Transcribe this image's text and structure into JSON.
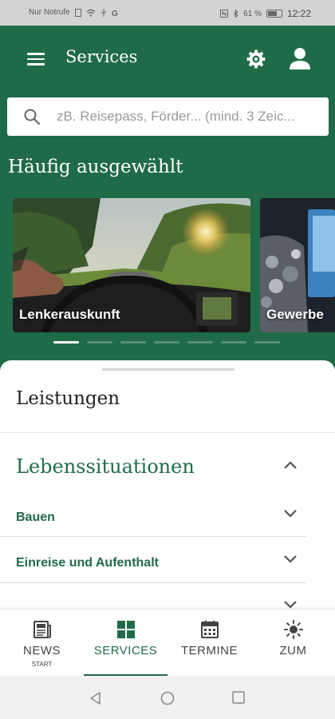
{
  "status_bar": {
    "carrier": "Nur Notrufe",
    "battery": "61 %",
    "time": "12:22"
  },
  "app_bar": {
    "title": "Services"
  },
  "search": {
    "placeholder": "zB. Reisepass, Förder... (mind. 3 Zeic..."
  },
  "frequent": {
    "title": "Häufig ausgewählt",
    "cards": [
      {
        "label": "Lenkerauskunft"
      },
      {
        "label": "Gewerbe"
      }
    ],
    "pager": {
      "count": 7,
      "active_index": 0
    }
  },
  "sheet": {
    "leistungen": "Leistungen",
    "lebens_title": "Lebenssituationen",
    "items": [
      {
        "label": "Bauen"
      },
      {
        "label": "Einreise und Aufenthalt"
      }
    ]
  },
  "bottom_nav": {
    "items": [
      {
        "label": "NEWS",
        "sublabel": "START",
        "icon": "newspaper-icon"
      },
      {
        "label": "SERVICES",
        "icon": "grid-icon",
        "active": true
      },
      {
        "label": "TERMINE",
        "icon": "calendar-icon"
      },
      {
        "label": "ZUM",
        "icon": "sun-icon"
      }
    ]
  },
  "colors": {
    "primary_green": "#1f6b48",
    "status_bar": "#d2d4d3",
    "system_nav": "#f1f1f1"
  }
}
